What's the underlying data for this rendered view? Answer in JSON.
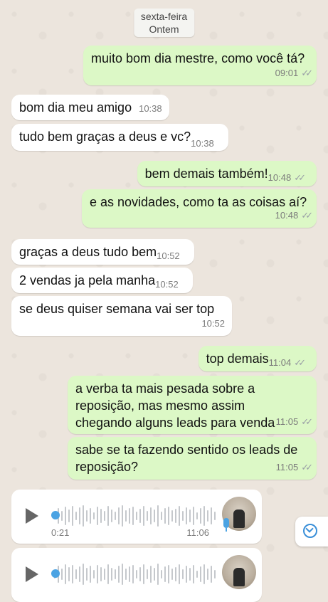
{
  "date_pill": {
    "line1": "sexta-feira",
    "line2": "Ontem"
  },
  "messages": [
    {
      "dir": "out",
      "text": "muito bom dia mestre, como você tá?",
      "time": "09:01"
    },
    {
      "dir": "in",
      "text": "bom dia meu amigo",
      "time": "10:38"
    },
    {
      "dir": "in",
      "text": "tudo bem graças a deus e vc?",
      "time": "10:38"
    },
    {
      "dir": "out",
      "text": "bem demais também!",
      "time": "10:48"
    },
    {
      "dir": "out",
      "text": "e as novidades, como ta as coisas aí?",
      "time": "10:48"
    },
    {
      "dir": "in",
      "text": "graças a deus tudo bem",
      "time": "10:52"
    },
    {
      "dir": "in",
      "text": "2 vendas ja pela manha",
      "time": "10:52"
    },
    {
      "dir": "in",
      "text": "se deus quiser semana vai ser top",
      "time": "10:52"
    },
    {
      "dir": "out",
      "text": "top demais",
      "time": "11:04"
    },
    {
      "dir": "out",
      "text": "a verba ta mais pesada sobre a reposição, mas mesmo assim chegando alguns leads para venda",
      "time": "11:05"
    },
    {
      "dir": "out",
      "text": "sabe se ta fazendo sentido os leads de reposição?",
      "time": "11:05"
    }
  ],
  "voice_note": {
    "duration": "0:21",
    "time": "11:06"
  },
  "icons": {
    "read_ticks": "double-check-icon",
    "play": "play-icon",
    "mic": "microphone-icon",
    "scroll": "chevron-down-circle-icon"
  },
  "colors": {
    "outgoing": "#dcf8c6",
    "incoming": "#ffffff",
    "background": "#ece5dd",
    "accent": "#4ba3e3"
  }
}
